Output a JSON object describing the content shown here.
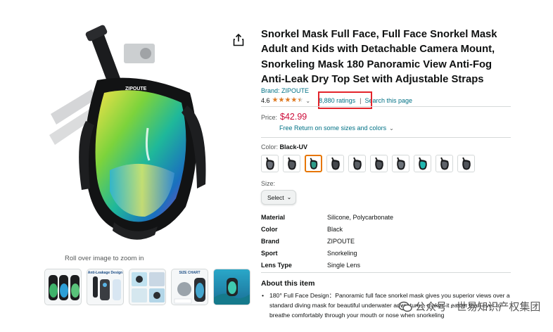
{
  "product": {
    "title": "Snorkel Mask Full Face, Full Face Snorkel Mask Adult and Kids with Detachable Camera Mount, Snorkeling Mask 180 Panoramic View Anti-Fog Anti-Leak Dry Top Set with Adjustable Straps",
    "brand_link": "Brand: ZIPOUTE",
    "rating_value": "4.6",
    "rating_stars": 4.5,
    "ratings_count_link": "8,880 ratings",
    "rating_separator": "|",
    "search_page_link": "Search this page",
    "price_label": "Price:",
    "price": "$42.99",
    "returns_link": "Free Return on some sizes and colors",
    "color_label": "Color:",
    "color_value": "Black-UV",
    "size_label": "Size:",
    "size_select_value": "Select",
    "mask_logo_text": "ZIPOUTE"
  },
  "gallery": {
    "zoom_hint": "Roll over image to zoom in",
    "thumbnails": [
      {
        "caption": "",
        "kind": "image"
      },
      {
        "caption": "Anti-Leakage Design",
        "kind": "image"
      },
      {
        "caption": "",
        "kind": "image"
      },
      {
        "caption": "SIZE CHART",
        "kind": "image"
      },
      {
        "caption": "",
        "kind": "video"
      }
    ]
  },
  "swatches": [
    {
      "tint": "#6b7078",
      "selected": false
    },
    {
      "tint": "#55595f",
      "selected": false
    },
    {
      "tint": "#2e9c8a",
      "selected": true
    },
    {
      "tint": "#45484d",
      "selected": false
    },
    {
      "tint": "#5a5e64",
      "selected": false
    },
    {
      "tint": "#4f5358",
      "selected": false
    },
    {
      "tint": "#6c7279",
      "selected": false
    },
    {
      "tint": "#1fb7b0",
      "selected": false
    },
    {
      "tint": "#5f636a",
      "selected": false
    },
    {
      "tint": "#50545a",
      "selected": false
    }
  ],
  "specs": [
    {
      "key": "Material",
      "value": "Silicone, Polycarbonate"
    },
    {
      "key": "Color",
      "value": "Black"
    },
    {
      "key": "Brand",
      "value": "ZIPOUTE"
    },
    {
      "key": "Sport",
      "value": "Snorkeling"
    },
    {
      "key": "Lens Type",
      "value": "Single Lens"
    }
  ],
  "about": {
    "title": "About this item",
    "bullet": "•",
    "text": "180° Full Face Design：Panoramic full face snorkel mask gives you superior views over a standard diving mask for beautiful underwater adventures, makes it easier than ever to breathe comfortably through your mouth or nose when snorkeling"
  },
  "watermark": {
    "text": "公众号 · 世易知识产权集团"
  },
  "colors": {
    "link": "#007185",
    "price": "#cc0c39",
    "star": "#de7921",
    "highlight_box": "#e3242b",
    "selected_swatch": "#e77600"
  },
  "icons": {
    "share": "share-icon",
    "rating_dropdown": "chevron-down-icon",
    "returns_dropdown": "chevron-down-icon",
    "size_dropdown": "chevron-down-icon",
    "watermark": "wechat-icon"
  }
}
